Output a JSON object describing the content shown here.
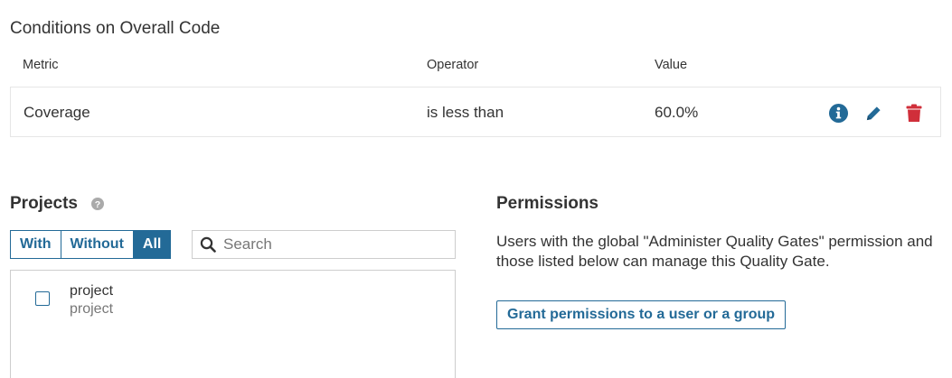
{
  "conditions": {
    "title": "Conditions on Overall Code",
    "headers": {
      "metric": "Metric",
      "operator": "Operator",
      "value": "Value"
    },
    "rows": [
      {
        "metric": "Coverage",
        "operator": "is less than",
        "value": "60.0%"
      }
    ],
    "row_icons": [
      "info-icon",
      "edit-pencil-icon",
      "trash-icon"
    ]
  },
  "projects": {
    "title": "Projects",
    "filters": [
      "With",
      "Without",
      "All"
    ],
    "active_filter": "All",
    "search_placeholder": "Search",
    "search_value": "",
    "items": [
      {
        "name": "project",
        "key": "project",
        "checked": false
      }
    ]
  },
  "permissions": {
    "title": "Permissions",
    "description": "Users with the global \"Administer Quality Gates\" permission and those listed below can manage this Quality Gate.",
    "grant_button": "Grant permissions to a user or a group"
  },
  "colors": {
    "accent": "#236a97",
    "info": "#236a97",
    "danger": "#d02f3a",
    "help_icon": "#aaaaaa"
  }
}
